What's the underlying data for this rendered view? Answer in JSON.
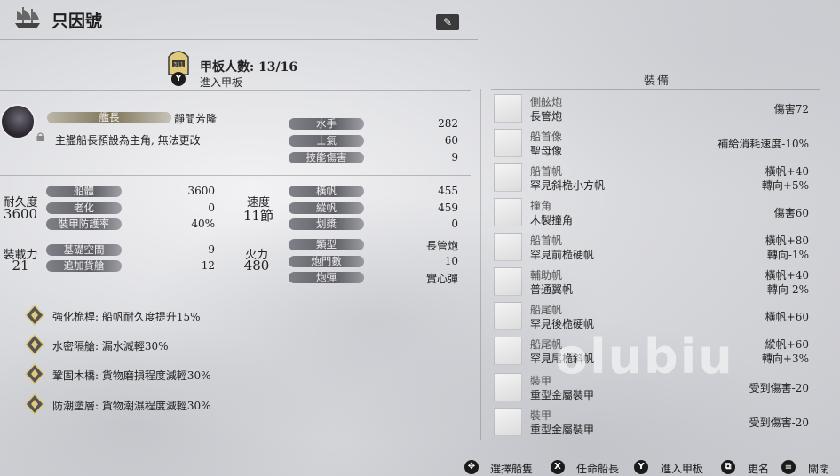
{
  "ship": {
    "name": "只因號",
    "edit_icon": "edit-icon"
  },
  "deck": {
    "count_text": "甲板人數: 13/16",
    "button": "Y",
    "enter_label": "進入甲板",
    "door_number": "311"
  },
  "captain": {
    "tag": "艦長",
    "name": "靜間芳隆",
    "note": "主艦船長預設為主角, 無法更改"
  },
  "crew_stats": [
    {
      "label": "水手",
      "value": "282"
    },
    {
      "label": "士氣",
      "value": "60"
    },
    {
      "label": "技能傷害",
      "value": "9"
    }
  ],
  "durability": {
    "label": "耐久度",
    "value": "3600",
    "rows": [
      {
        "label": "船體",
        "value": "3600"
      },
      {
        "label": "老化",
        "value": "0"
      },
      {
        "label": "裝甲防護率",
        "value": "40%"
      }
    ]
  },
  "capacity": {
    "label": "裝載力",
    "value": "21",
    "rows": [
      {
        "label": "基礎空間",
        "value": "9"
      },
      {
        "label": "追加貨艙",
        "value": "12"
      }
    ]
  },
  "speed": {
    "label": "速度",
    "value": "11節",
    "rows": [
      {
        "label": "橫帆",
        "value": "455"
      },
      {
        "label": "縱帆",
        "value": "459"
      },
      {
        "label": "划槳",
        "value": "0"
      }
    ]
  },
  "firepower": {
    "label": "火力",
    "value": "480",
    "rows": [
      {
        "label": "類型",
        "value": "長管炮"
      },
      {
        "label": "炮門數",
        "value": "10"
      },
      {
        "label": "炮彈",
        "value": "實心彈"
      }
    ]
  },
  "skills": [
    {
      "text": "強化桅桿: 船帆耐久度提升15%"
    },
    {
      "text": "水密隔艙: 漏水減輕30%"
    },
    {
      "text": "鞏固木橋: 貨物磨損程度減輕30%"
    },
    {
      "text": "防潮塗層: 貨物潮濕程度減輕30%"
    }
  ],
  "equipment": {
    "title": "裝備",
    "items": [
      {
        "type": "側舷炮",
        "name": "長管炮",
        "stat1": "傷害72",
        "stat2": ""
      },
      {
        "type": "船首像",
        "name": "聖母像",
        "stat1": "補給消耗速度-10%",
        "stat2": ""
      },
      {
        "type": "船首帆",
        "name": "罕見斜桅小方帆",
        "stat1": "橫帆+40",
        "stat2": "轉向+5%"
      },
      {
        "type": "撞角",
        "name": "木製撞角",
        "stat1": "傷害60",
        "stat2": ""
      },
      {
        "type": "船首帆",
        "name": "罕見前桅硬帆",
        "stat1": "橫帆+80",
        "stat2": "轉向-1%"
      },
      {
        "type": "輔助帆",
        "name": "普通翼帆",
        "stat1": "橫帆+40",
        "stat2": "轉向-2%"
      },
      {
        "type": "船尾帆",
        "name": "罕見後桅硬帆",
        "stat1": "橫帆+60",
        "stat2": ""
      },
      {
        "type": "船尾帆",
        "name": "罕見尾桅斜帆",
        "stat1": "縱帆+60",
        "stat2": "轉向+3%"
      },
      {
        "type": "裝甲",
        "name": "重型金屬裝甲",
        "stat1": "受到傷害-20",
        "stat2": ""
      },
      {
        "type": "裝甲",
        "name": "重型金屬裝甲",
        "stat1": "受到傷害-20",
        "stat2": ""
      }
    ]
  },
  "footer": [
    {
      "button": "✥",
      "label": "選擇船隻",
      "icon": "dpad-icon"
    },
    {
      "button": "X",
      "label": "任命船長",
      "icon": "x-button-icon"
    },
    {
      "button": "Y",
      "label": "進入甲板",
      "icon": "y-button-icon"
    },
    {
      "button": "⧉",
      "label": "更名",
      "icon": "view-button-icon"
    },
    {
      "button": "≡",
      "label": "關閉",
      "icon": "menu-button-icon"
    }
  ],
  "watermark": "olubiu"
}
